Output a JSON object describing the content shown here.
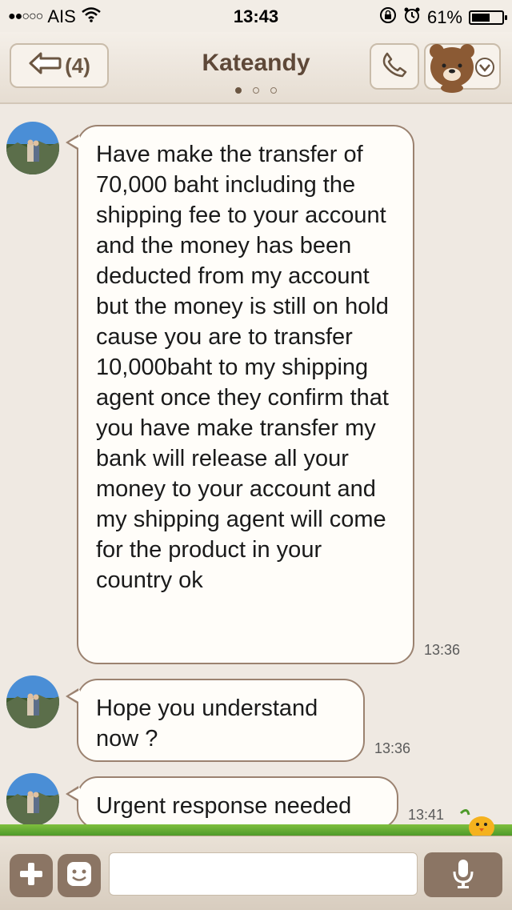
{
  "status_bar": {
    "carrier": "AIS",
    "time": "13:43",
    "battery": "61%",
    "battery_level": 0.61
  },
  "nav": {
    "back_label": "(4)",
    "title": "Kateandy",
    "pager_dots": 3,
    "pager_active": 0
  },
  "messages": [
    {
      "text": "Have make the transfer of 70,000 baht including the shipping fee to your account and the money has been deducted from my account but the money is still on hold cause you are to transfer 10,000baht to my shipping agent once they confirm that you have make transfer my bank will release all your money to your account and my shipping agent will come for the product in your country ok",
      "time": "13:36"
    },
    {
      "text": "Hope you understand now ?",
      "time": "13:36"
    },
    {
      "text": "Urgent response needed",
      "time": "13:41"
    }
  ],
  "input": {
    "placeholder": ""
  },
  "colors": {
    "accent_brown": "#8b7564",
    "bubble_border": "#9b8270",
    "background": "#efe9e2"
  },
  "icons": [
    "wifi-icon",
    "lock-rotation-icon",
    "alarm-icon",
    "back-arrow-icon",
    "phone-icon",
    "brown-bear-icon",
    "chevron-down-icon",
    "plus-icon",
    "emoticon-icon",
    "mic-icon",
    "chick-icon"
  ]
}
